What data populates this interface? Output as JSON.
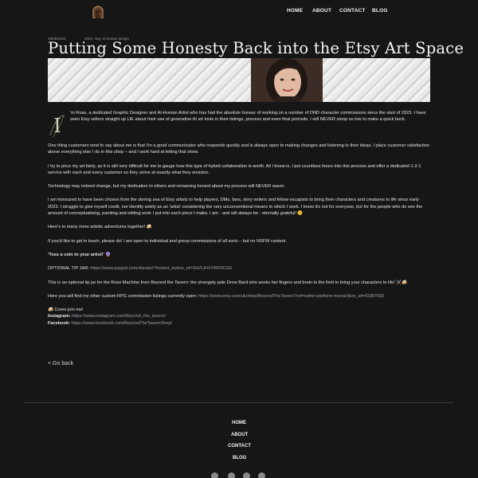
{
  "header": {
    "logo_icon": "tavern-door-icon",
    "nav": [
      "HOME",
      "ABOUT",
      "CONTACT",
      "BLOG"
    ]
  },
  "post": {
    "date": "29/05/2024",
    "categories": "artist, etsy, ai-human design",
    "title": "Putting Some Honesty Back into the Etsy Art Space",
    "dropcap_letter": "I",
    "paragraphs": [
      "'m Rose, a dedicated Graphic Designer and AI-Human Artist who has had the absolute honour of working on a number of DND character commissions since the start of 2023. I have seen Etsy sellers straight up LIE about their use of generative AI art tools in their listings, process and even final portraits. I will NEVER stoop so low to make a quick buck.",
      "One thing customers tend to say about me is that I'm a good communicator who responds quickly and is always open to making changes and listening to their ideas. I place customer satisfaction above everything else I do in this shop – and I work hard at letting that show.",
      "I try to price my art fairly, as it is still very difficult for me to gauge how this type of hybrid collaboration is worth. All I know is, I put countless hours into this process and offer a dedicated 1-2-1 service with each and every customer so they arrive at exactly what they envision.",
      "Technology may indeed change, but my dedication to others and remaining honest about my process will NEVER waver.",
      "I am honoured to have been chosen from the stirring sea of Etsy artists to help players, DMs, fans, story writers and fellow escapists to bring their characters and creatures to life since early 2023. I struggle to give myself credit, nor identify solely as an 'artist' considering the very unconventional means to which I work. I know it's not for everyone, but for the people who do see the amount of conceptualising, painting and editing work I put into each piece I make, I am - and will always be - eternally grateful! 😊",
      "Here's to many more artistic adventures together! 🍻",
      "If you'd like to get in touch, please do! I am open to individual and group commissions of all sorts – but no NSFW content."
    ],
    "toss_line": "'Toss a coin to your artist!' 🔮",
    "tip_label": "OPTIONAL TIP JAR: ",
    "tip_url": "https://www.paypal.com/donate/?hosted_button_id=SHZUHXYRR9CG6",
    "tip_note": "This is an optional tip jar for the Rose Machine from Beyond the Tavern: the strangely pale Drow Bard who works her fingers and brain to the limit to bring your characters to life! ⚔️🍻",
    "rpg_label": "Here you will find my other custom RPG commission listings currently open: ",
    "rpg_url": "https://www.etsy.com/uk/shop/BeyondTheTavern?ref=seller-platform-mcnav§ion_id=41987690",
    "join_line": "🍻 Come join me!",
    "instagram_label": "Instagram: ",
    "instagram_url": "https://www.instagram.com/beyond_the_tavern/",
    "facebook_label": "Facebook: ",
    "facebook_url": "https://www.facebook.com/BeyondTheTavernShop/",
    "back_link": "<  Go back"
  },
  "footer": {
    "nav": [
      "HOME",
      "ABOUT",
      "CONTACT",
      "BLOG"
    ],
    "social_icons": [
      "etsy-icon",
      "facebook-icon",
      "instagram-icon",
      "email-icon"
    ]
  }
}
